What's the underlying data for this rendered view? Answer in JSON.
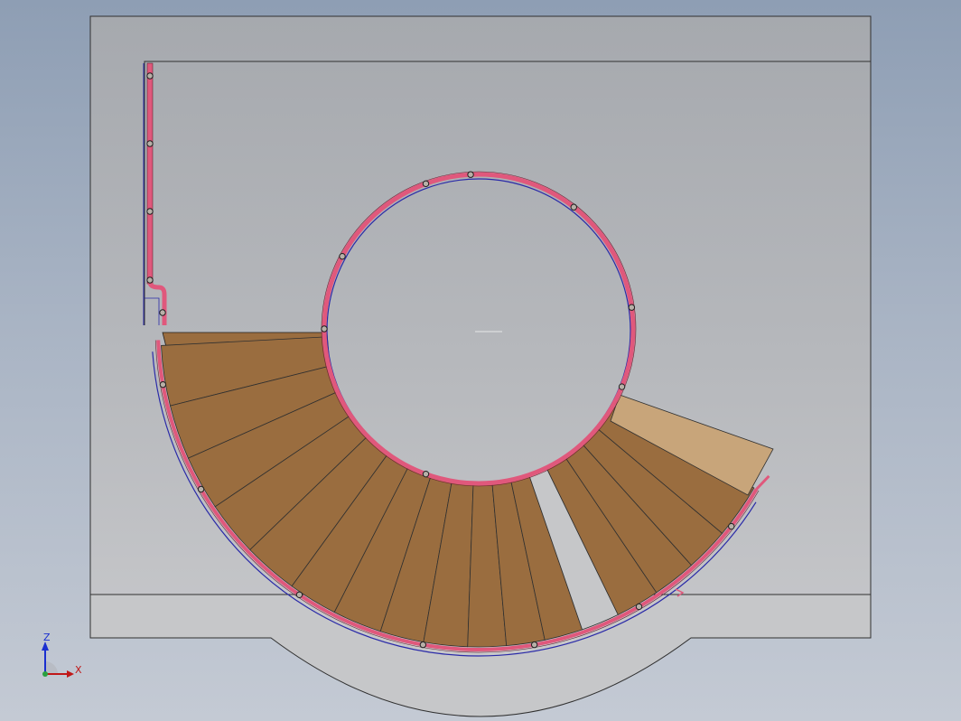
{
  "viewport": {
    "background_top": "#8e9eb4",
    "background_bottom": "#c4cad4"
  },
  "model": {
    "wall_color": "#c4c6ca",
    "tread_color": "#9a6d3f",
    "landing_color": "#c8a57a",
    "gap_color": "#c6c7c9",
    "rail_color": "#e0587c",
    "rail_outline_color": "#2a2aa8",
    "edge_color": "#303030"
  },
  "triad": {
    "z_label": "Z",
    "x_label": "X",
    "z_color": "#1a2fd0",
    "x_color": "#c01818"
  }
}
